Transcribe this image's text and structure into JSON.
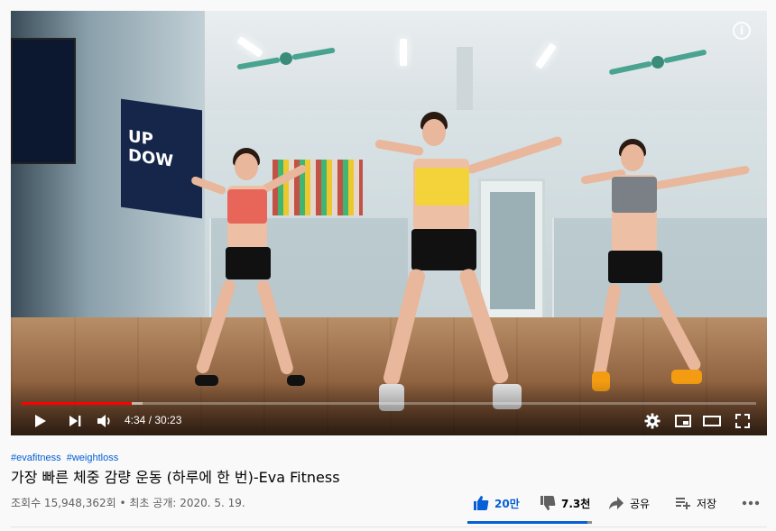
{
  "player": {
    "current_time": "4:34",
    "duration": "30:23",
    "time_display": "4:34 / 30:23",
    "played_fraction": 0.15,
    "buffered_fraction": 0.165,
    "info_glyph": "i",
    "banner_text": "UP DOW"
  },
  "video": {
    "hashtags": [
      "#evafitness",
      "#weightloss"
    ],
    "title": "가장 빠른 체중 감량 운동 (하루에 한 번)-Eva Fitness",
    "meta": "조회수 15,948,362회 • 최초 공개: 2020. 5. 19."
  },
  "actions": {
    "like_count": "20만",
    "dislike_count": "7.3천",
    "share_label": "공유",
    "save_label": "저장",
    "like_ratio": 0.965
  },
  "colors": {
    "accent": "#065fd4",
    "progress": "#ff0000"
  }
}
